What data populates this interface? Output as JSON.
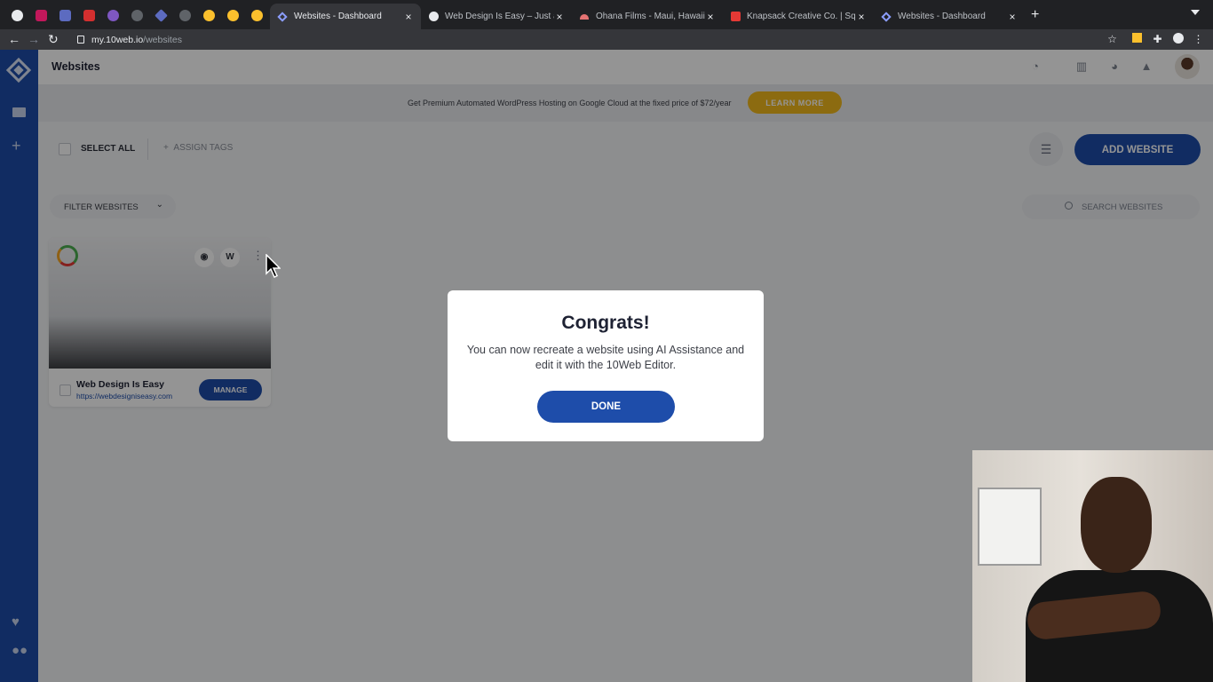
{
  "browser": {
    "tabs": [
      {
        "title": "Websites - Dashboard",
        "active": true
      },
      {
        "title": "Web Design Is Easy – Just and",
        "active": false
      },
      {
        "title": "Ohana Films - Maui, Hawaii Lu",
        "active": false
      },
      {
        "title": "Knapsack Creative Co. | Squar",
        "active": false
      },
      {
        "title": "Websites - Dashboard",
        "active": false
      }
    ],
    "url_host": "my.10web.io",
    "url_path": "/websites"
  },
  "header": {
    "title": "Websites"
  },
  "promo": {
    "text": "Get Premium Automated WordPress Hosting on Google Cloud at the fixed price of $72/year",
    "button": "LEARN MORE"
  },
  "toolbar": {
    "select_all": "SELECT ALL",
    "assign_tags": "ASSIGN TAGS",
    "add_website": "ADD WEBSITE"
  },
  "filter": {
    "label": "FILTER WEBSITES"
  },
  "search": {
    "placeholder": "SEARCH WEBSITES"
  },
  "website_card": {
    "name": "Web Design Is Easy",
    "url": "https://webdesigniseasy.com",
    "manage": "MANAGE",
    "wp_badge": "W"
  },
  "modal": {
    "title": "Congrats!",
    "message": "You can now recreate a website using AI Assistance and edit it with the 10Web Editor.",
    "button": "DONE"
  },
  "colors": {
    "brand_blue": "#1e4daa",
    "promo_yellow": "#f2b91c"
  }
}
